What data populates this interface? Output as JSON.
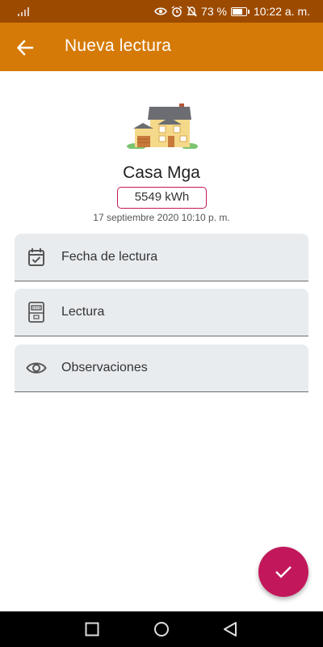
{
  "status_bar": {
    "battery_percent": "73 %",
    "battery_level": 0.73,
    "time": "10:22 a. m.",
    "icons": [
      "signal-icon",
      "eye-icon",
      "alarm-icon",
      "mute-icon",
      "battery-icon"
    ]
  },
  "app_bar": {
    "title": "Nueva lectura",
    "back_icon": "arrow-left-icon"
  },
  "property": {
    "image": "house-icon",
    "name": "Casa Mga",
    "reading": "5549 kWh",
    "timestamp": "17 septiembre 2020 10:10 p. m."
  },
  "fields": {
    "date": {
      "label": "Fecha de lectura",
      "icon": "calendar-check-icon"
    },
    "reading": {
      "label": "Lectura",
      "icon": "meter-icon"
    },
    "observations": {
      "label": "Observaciones",
      "icon": "eye-icon"
    }
  },
  "fab": {
    "icon": "check-icon"
  },
  "colors": {
    "status_bar": "#9c4a00",
    "app_bar": "#d57a06",
    "accent": "#c2185b",
    "field_bg": "#e9ecef"
  },
  "nav_bar": {
    "icons": [
      "recents-square-icon",
      "home-circle-icon",
      "back-triangle-icon"
    ]
  }
}
